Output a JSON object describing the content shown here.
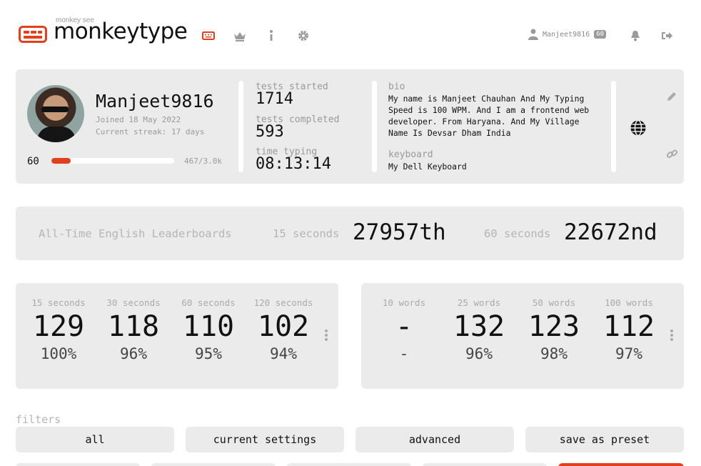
{
  "header": {
    "logo_top": "monkey see",
    "logo_text": "monkeytype",
    "icons": [
      "keyboard-icon",
      "crown-icon",
      "info-icon",
      "gear-icon"
    ],
    "username": "Manjeet9816",
    "level_badge": "60",
    "colors": {
      "accent": "#e2401c",
      "muted": "#9a9a9a"
    }
  },
  "profile": {
    "name": "Manjeet9816",
    "joined": "Joined 18 May 2022",
    "streak": "Current streak: 17 days",
    "level": "60",
    "xp_text": "467/3.0k",
    "xp_progress": 0.156,
    "stats": {
      "tests_started_label": "tests started",
      "tests_started": "1714",
      "tests_completed_label": "tests completed",
      "tests_completed": "593",
      "time_typing_label": "time typing",
      "time_typing": "08:13:14"
    },
    "bio_label": "bio",
    "bio": "My name is Manjeet Chauhan And My Typing Speed is 100 WPM. And I am a frontend web developer. From Haryana. And My Village Name Is Devsar Dham India",
    "keyboard_label": "keyboard",
    "keyboard": "My Dell Keyboard"
  },
  "leaderboard": {
    "title": "All-Time English Leaderboards",
    "entries": [
      {
        "label": "15 seconds",
        "rank": "27957th"
      },
      {
        "label": "60 seconds",
        "rank": "22672nd"
      }
    ]
  },
  "pb_time": [
    {
      "label": "15 seconds",
      "wpm": "129",
      "acc": "100%"
    },
    {
      "label": "30 seconds",
      "wpm": "118",
      "acc": "96%"
    },
    {
      "label": "60 seconds",
      "wpm": "110",
      "acc": "95%"
    },
    {
      "label": "120 seconds",
      "wpm": "102",
      "acc": "94%"
    }
  ],
  "pb_words": [
    {
      "label": "10 words",
      "wpm": "-",
      "acc": "-"
    },
    {
      "label": "25 words",
      "wpm": "132",
      "acc": "96%"
    },
    {
      "label": "50 words",
      "wpm": "123",
      "acc": "98%"
    },
    {
      "label": "100 words",
      "wpm": "112",
      "acc": "97%"
    }
  ],
  "filters": {
    "label": "filters",
    "buttons": [
      "all",
      "current settings",
      "advanced",
      "save as preset"
    ]
  }
}
